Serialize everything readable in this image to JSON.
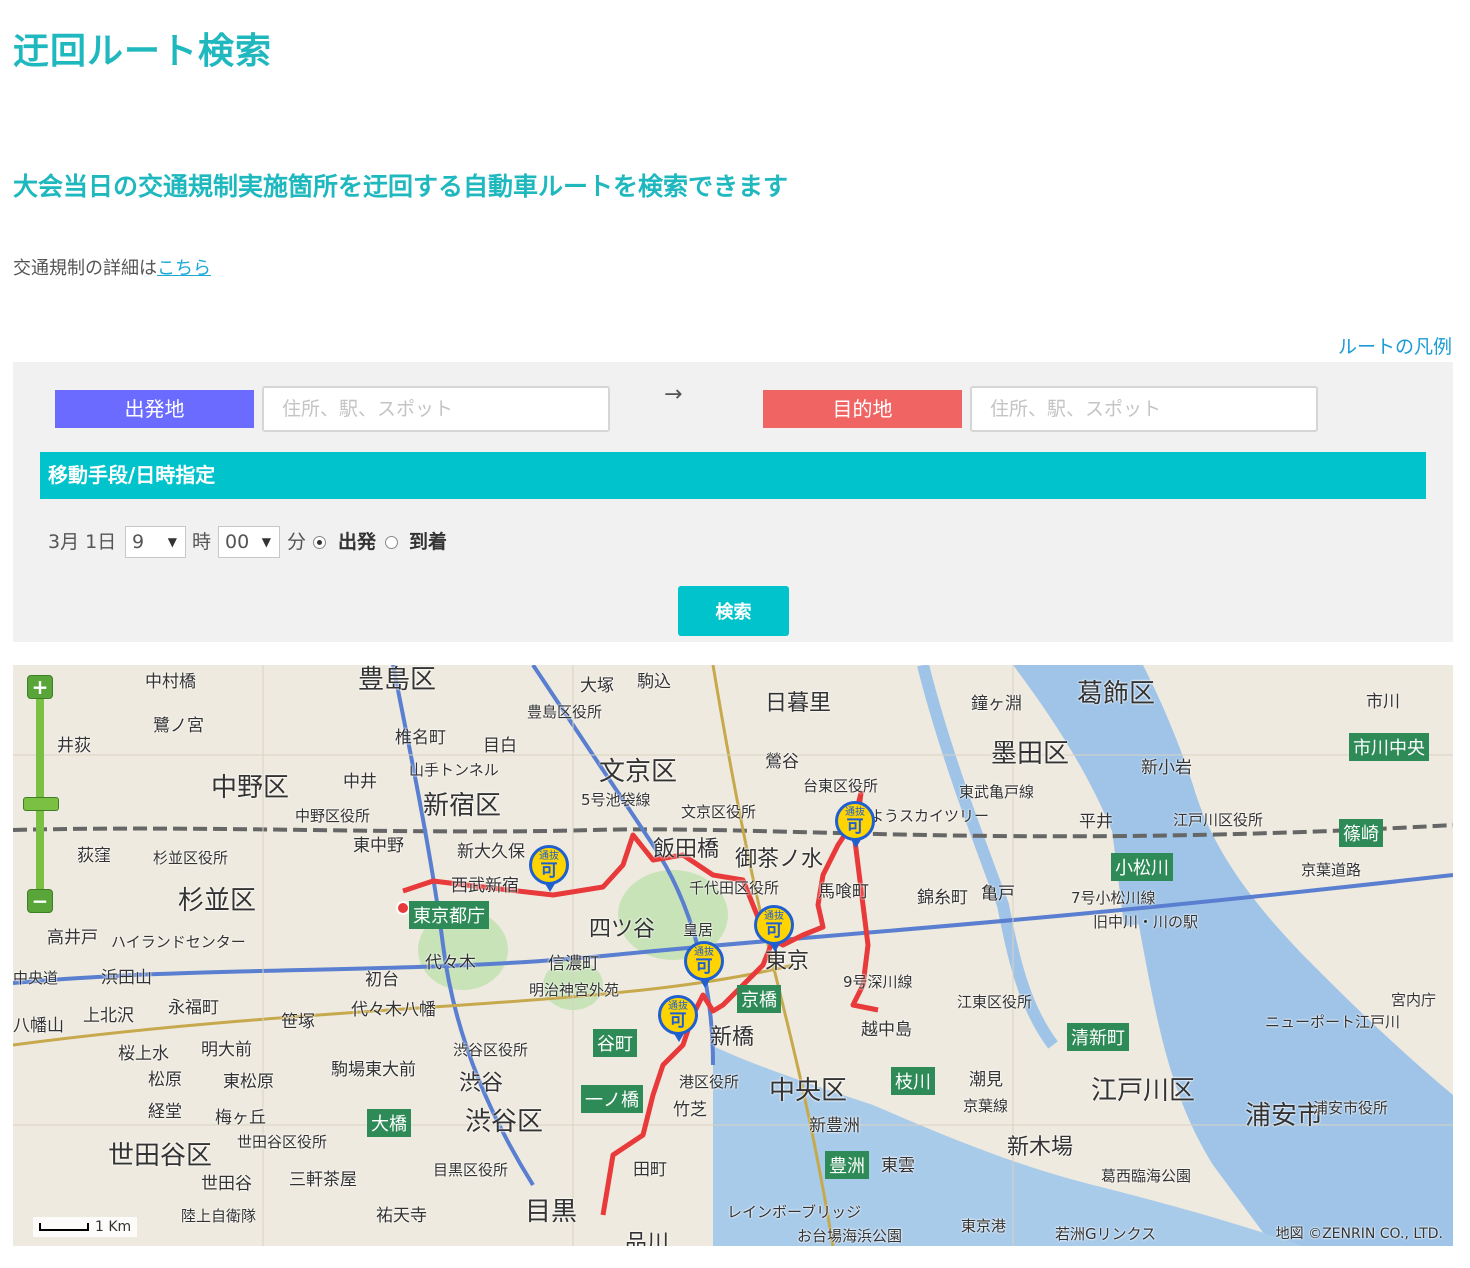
{
  "page": {
    "title": "迂回ルート検索",
    "lead": "大会当日の交通規制実施箇所を迂回する自動車ルートを検索できます",
    "detail_text": "交通規制の詳細は",
    "detail_link": "こちら",
    "legend_link": "ルートの凡例"
  },
  "search": {
    "origin_label": "出発地",
    "origin_placeholder": "住所、駅、スポット",
    "arrow": "→",
    "dest_label": "目的地",
    "dest_placeholder": "住所、駅、スポット",
    "section_title": "移動手段/日時指定",
    "date": "3月 1日",
    "hour_value": "9",
    "hour_unit": "時",
    "minute_value": "00",
    "minute_unit": "分",
    "departure_label": "出発",
    "arrival_label": "到着",
    "departure_selected": true,
    "button_label": "検索",
    "colors": {
      "accent": "#00c3cb",
      "origin": "#6b6bff",
      "dest": "#f16464",
      "title": "#1fb8bf"
    }
  },
  "map": {
    "wards": [
      "豊島区",
      "中野区",
      "新宿区",
      "文京区",
      "杉並区",
      "葛飾区",
      "墨田区",
      "渋谷区",
      "世田谷区",
      "中央区",
      "江戸川区",
      "浦安市"
    ],
    "towns": [
      "中村橋",
      "鷺ノ宮",
      "井荻",
      "荻窪",
      "高井戸",
      "浜田山",
      "永福町",
      "八幡山",
      "上北沢",
      "桜上水",
      "明大前",
      "松原",
      "東松原",
      "経堂",
      "梅ヶ丘",
      "世田谷",
      "三軒茶屋",
      "祐天寺",
      "目黒",
      "代々木",
      "初台",
      "笹塚",
      "代々木八幡",
      "駒場東大前",
      "渋谷",
      "新大久保",
      "西武新宿",
      "東中野",
      "中井",
      "椎名町",
      "目白",
      "大塚",
      "駒込",
      "日暮里",
      "鶯谷",
      "東京",
      "新橋",
      "京橋",
      "田町",
      "品川",
      "竹芝",
      "新豊洲",
      "豊洲",
      "東雲",
      "新木場",
      "越中島",
      "潮見",
      "錦糸町",
      "亀戸",
      "平井",
      "新小岩",
      "市川",
      "篠崎",
      "馬喰町",
      "信濃町",
      "四ツ谷",
      "飯田橋",
      "御茶ノ水",
      "谷町",
      "一ノ橋",
      "大橋",
      "枝川",
      "清新町",
      "小松川",
      "市川中央",
      "鐘ヶ淵"
    ],
    "highlighted": [
      "東京都庁",
      "大橋",
      "谷町",
      "一ノ橋",
      "枝川",
      "清新町",
      "小松川",
      "市川中央",
      "篠崎",
      "豊洲",
      "京橋"
    ],
    "spots": [
      "杉並区役所",
      "中野区役所",
      "豊島区役所",
      "文京区役所",
      "台東区役所",
      "千代田区役所",
      "渋谷区役所",
      "港区役所",
      "目黒区役所",
      "世田谷区役所",
      "江東区役所",
      "江戸川区役所",
      "浦安市役所",
      "明治神宮外苑",
      "皇居",
      "ハイランドセンター",
      "山手トンネル",
      "5号池袋線",
      "東武亀戸線",
      "7号小松川線",
      "旧中川・川の駅",
      "9号深川線",
      "京葉線",
      "京葉道路",
      "レインボーブリッジ",
      "お台場海浜公園",
      "東京港",
      "若洲Gリンクス",
      "葛西臨海公園",
      "ニューポート江戸川",
      "宮内庁",
      "陸上自衛隊",
      "ようスカイツリー",
      "中央道",
      "江東区役所"
    ],
    "pin_labels": {
      "top": "通抜",
      "bottom": "可"
    },
    "scale_label": "1 Km",
    "copyright": "地図 ©ZENRIN CO., LTD.",
    "route_color": "#e83a3a"
  }
}
